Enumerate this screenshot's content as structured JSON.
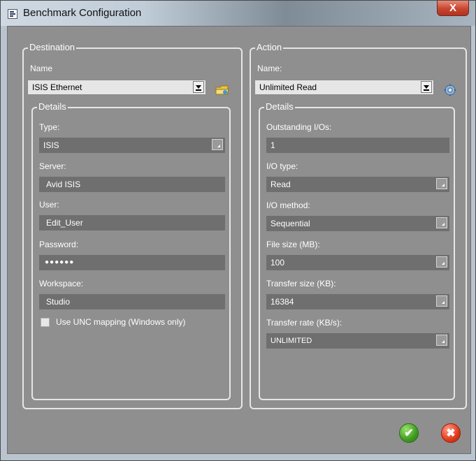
{
  "window": {
    "title": "Benchmark Configuration",
    "close_label": "X"
  },
  "destination": {
    "legend": "Destination",
    "name_label": "Name",
    "name_value": "ISIS Ethernet",
    "details": {
      "legend": "Details",
      "type_label": "Type:",
      "type_value": "ISIS",
      "server_label": "Server:",
      "server_value": "Avid ISIS",
      "user_label": "User:",
      "user_value": "Edit_User",
      "password_label": "Password:",
      "password_value": "●●●●●●",
      "workspace_label": "Workspace:",
      "workspace_value": "Studio",
      "unc_label": "Use UNC mapping (Windows only)",
      "unc_checked": false
    }
  },
  "action": {
    "legend": "Action",
    "name_label": "Name:",
    "name_value": "Unlimited Read",
    "details": {
      "legend": "Details",
      "outstanding_label": "Outstanding I/Os:",
      "outstanding_value": "1",
      "io_type_label": "I/O type:",
      "io_type_value": "Read",
      "io_method_label": "I/O method:",
      "io_method_value": "Sequential",
      "file_size_label": "File size (MB):",
      "file_size_value": "100",
      "transfer_size_label": "Transfer size (KB):",
      "transfer_size_value": "16384",
      "transfer_rate_label": "Transfer rate (KB/s):",
      "transfer_rate_value": "UNLIMITED"
    }
  },
  "buttons": {
    "ok_icon": "check-icon",
    "cancel_icon": "x-icon"
  },
  "colors": {
    "panel": "#8f8f8f",
    "field": "#6f6f6f",
    "ok": "#3d9b1f",
    "cancel": "#e03a1c"
  }
}
